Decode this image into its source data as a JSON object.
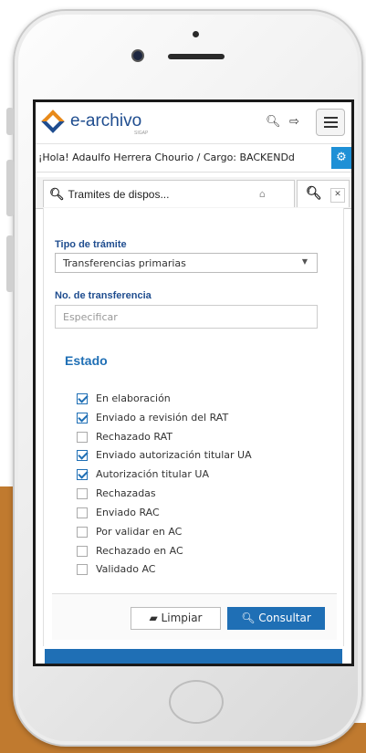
{
  "app": {
    "logo_text": "e-archivo",
    "logo_subtext": "SIGAP",
    "icons": [
      "search-icon",
      "logout-icon",
      "hamburger-menu-icon",
      "gear-icon",
      "home-icon",
      "close-icon"
    ]
  },
  "header": {
    "greeting": "¡Hola! Adaulfo Herrera Chourio / Cargo: BACKENDd"
  },
  "tabs": [
    {
      "label": "Tramites de dispos..."
    }
  ],
  "form": {
    "tipo_label": "Tipo de trámite",
    "tipo_value": "Transferencias primarias",
    "transferencia_label": "No. de transferencia",
    "transferencia_placeholder": "Especificar",
    "estado_heading": "Estado",
    "estados": [
      {
        "label": "En elaboración",
        "checked": true
      },
      {
        "label": "Enviado a revisión del RAT",
        "checked": true
      },
      {
        "label": "Rechazado RAT",
        "checked": false
      },
      {
        "label": "Enviado autorización titular UA",
        "checked": true
      },
      {
        "label": "Autorización titular UA",
        "checked": true
      },
      {
        "label": "Rechazadas",
        "checked": false
      },
      {
        "label": "Enviado RAC",
        "checked": false
      },
      {
        "label": "Por validar en AC",
        "checked": false
      },
      {
        "label": "Rechazado en AC",
        "checked": false
      },
      {
        "label": "Validado AC",
        "checked": false
      }
    ]
  },
  "buttons": {
    "clear_label": "Limpiar",
    "query_label": "Consultar"
  },
  "colors": {
    "brand_blue": "#1f6fb5",
    "brand_orange": "#e88a1a",
    "background_orange": "#c07a2f"
  }
}
